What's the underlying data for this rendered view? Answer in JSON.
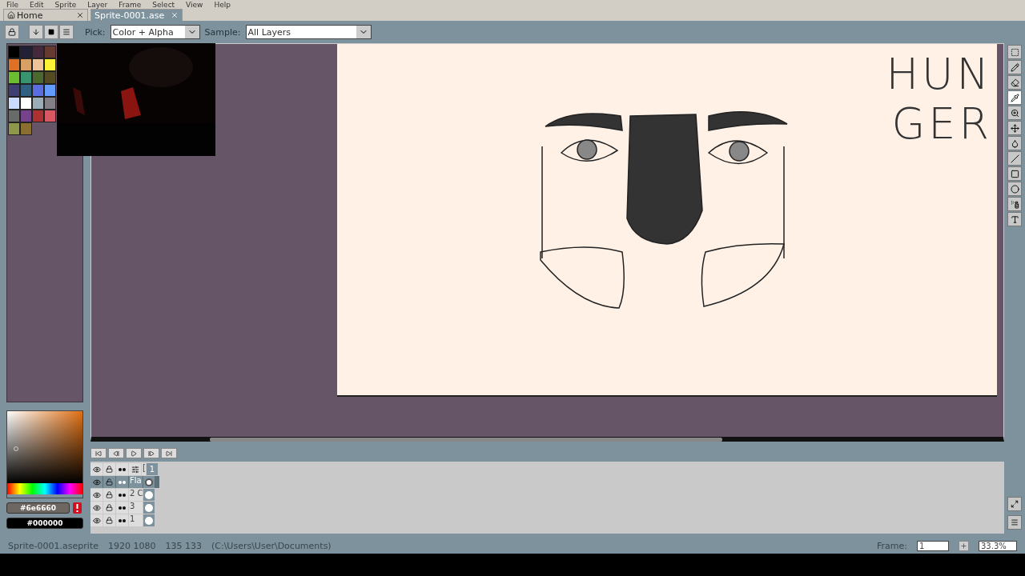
{
  "menu": [
    "File",
    "Edit",
    "Sprite",
    "Layer",
    "Frame",
    "Select",
    "View",
    "Help"
  ],
  "tabs": [
    {
      "label": "Home",
      "kind": "home",
      "selected": false
    },
    {
      "label": "Sprite-0001.ase",
      "kind": "file",
      "selected": true
    }
  ],
  "toolbar": {
    "pick_label": "Pick:",
    "pick_value": "Color + Alpha",
    "sample_label": "Sample:",
    "sample_value": "All Layers"
  },
  "palette": [
    {
      "color": "#000000"
    },
    {
      "color": "#222034"
    },
    {
      "color": "#45283c"
    },
    {
      "color": "#663931"
    },
    {
      "color": "#df7126"
    },
    {
      "color": "#d9a066"
    },
    {
      "color": "#eec39a"
    },
    {
      "color": "#fbf236"
    },
    {
      "color": "#6abe30"
    },
    {
      "color": "#37946e"
    },
    {
      "color": "#4b692f"
    },
    {
      "color": "#524b24"
    },
    {
      "color": "#3f3f74"
    },
    {
      "color": "#306082"
    },
    {
      "color": "#5b6ee1"
    },
    {
      "color": "#639bff"
    },
    {
      "color": "#cbdbfc"
    },
    {
      "color": "#ffffff"
    },
    {
      "color": "#9badb7"
    },
    {
      "color": "#847e87"
    },
    {
      "color": "#696a6a"
    },
    {
      "color": "#76428a"
    },
    {
      "color": "#ac3232"
    },
    {
      "color": "#d95763"
    },
    {
      "color": "#8f974a"
    },
    {
      "color": "#8a6f30"
    }
  ],
  "canvas": {
    "text_lines": [
      "HUN",
      "GER"
    ]
  },
  "colors": {
    "foreground": "#6e6660",
    "background": "#000000"
  },
  "tools": [
    {
      "kind": "marquee",
      "selected": false
    },
    {
      "kind": "pencil",
      "selected": false
    },
    {
      "kind": "eraser",
      "selected": false
    },
    {
      "kind": "eyedropper",
      "selected": true
    },
    {
      "kind": "zoom",
      "selected": false
    },
    {
      "kind": "move",
      "selected": false
    },
    {
      "kind": "bucket",
      "selected": false
    },
    {
      "kind": "line",
      "selected": false
    },
    {
      "kind": "rectangle",
      "selected": false
    },
    {
      "kind": "ellipse",
      "selected": false
    },
    {
      "kind": "spray",
      "selected": false
    },
    {
      "kind": "text",
      "selected": false
    }
  ],
  "timeline": {
    "frame_header": "1",
    "layers": [
      {
        "name": "[",
        "selected": false
      },
      {
        "name": "Fla",
        "selected": true
      },
      {
        "name": "2 C",
        "selected": false
      },
      {
        "name": "3",
        "selected": false
      },
      {
        "name": "1",
        "selected": false
      }
    ]
  },
  "status_bar": {
    "file": "Sprite-0001.aseprite",
    "size": "1920  1080",
    "position": "135  133",
    "path": "(C:\\Users\\User\\Documents)",
    "frame_label": "Frame:",
    "frame_value": "1",
    "zoom": "33.3%"
  }
}
